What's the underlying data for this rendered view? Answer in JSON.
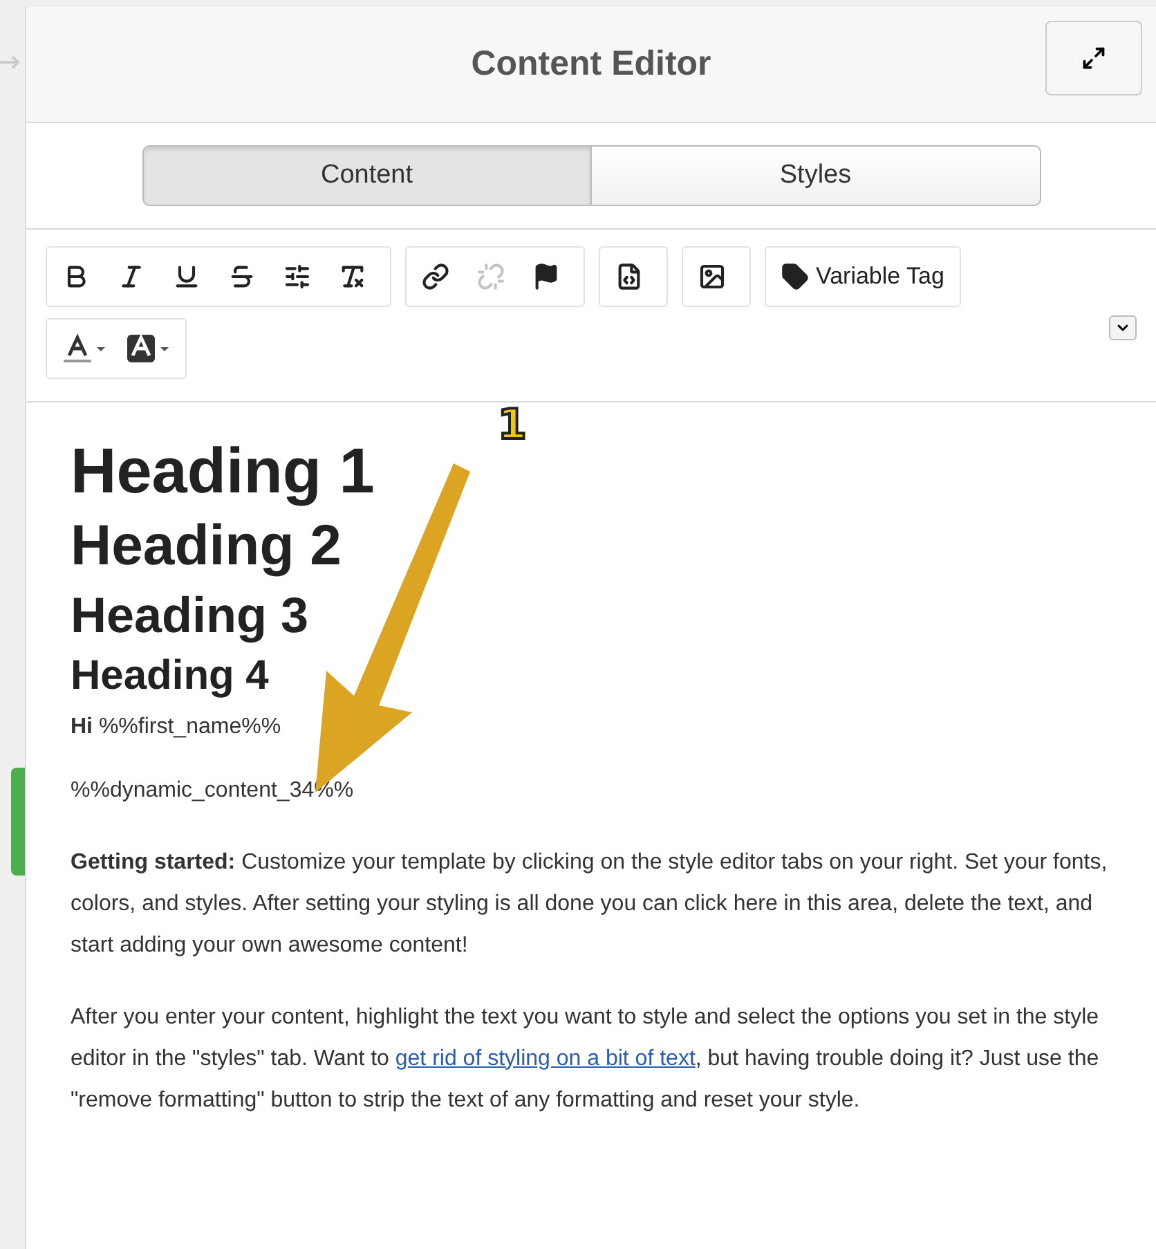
{
  "header": {
    "title": "Content Editor"
  },
  "tabs": [
    {
      "label": "Content",
      "selected": true
    },
    {
      "label": "Styles",
      "selected": false
    }
  ],
  "toolbar": [
    [
      {
        "items": [
          {
            "kind": "bold",
            "disabled": false
          },
          {
            "kind": "italic",
            "disabled": false
          },
          {
            "kind": "underline",
            "disabled": false
          },
          {
            "kind": "strike",
            "disabled": false
          },
          {
            "kind": "lines",
            "disabled": false
          },
          {
            "kind": "clear",
            "disabled": false
          }
        ]
      },
      {
        "items": [
          {
            "kind": "link",
            "disabled": false
          },
          {
            "kind": "unlink",
            "disabled": true
          },
          {
            "kind": "flag",
            "disabled": false
          }
        ]
      },
      {
        "items": [
          {
            "kind": "code",
            "disabled": false
          }
        ]
      },
      {
        "items": [
          {
            "kind": "image",
            "disabled": false
          }
        ]
      },
      {
        "items": [
          {
            "kind": "tag",
            "disabled": false,
            "label": "Variable Tag"
          }
        ]
      }
    ],
    [
      {
        "items": [
          {
            "kind": "textcolor",
            "disabled": false
          },
          {
            "kind": "bgcolor",
            "disabled": false
          }
        ]
      }
    ]
  ],
  "headings": [
    "Heading 1",
    "Heading 2",
    "Heading 3",
    "Heading 4"
  ],
  "greeting": "**Hi** %%first_name%%",
  "dynamic": "%%dynamic_content_34%%",
  "paragraphs": [
    {
      "before": "**Getting started:** Customize your template by clicking on the style editor tabs on your right. Set your fonts, colors, and styles. After setting your styling is all done you can click here in this area, delete the text, and start adding your own awesome content!"
    },
    {
      "before": "After you enter your content, highlight the text you want to style and select the options you set in the style editor in the \"styles\" tab. Want to ",
      "link": "get rid of styling on a bit of text",
      "after": ", but having trouble doing it? Just use the \"remove formatting\" button to strip the text of any formatting and reset your style."
    }
  ],
  "annotation": {
    "label": "1"
  }
}
